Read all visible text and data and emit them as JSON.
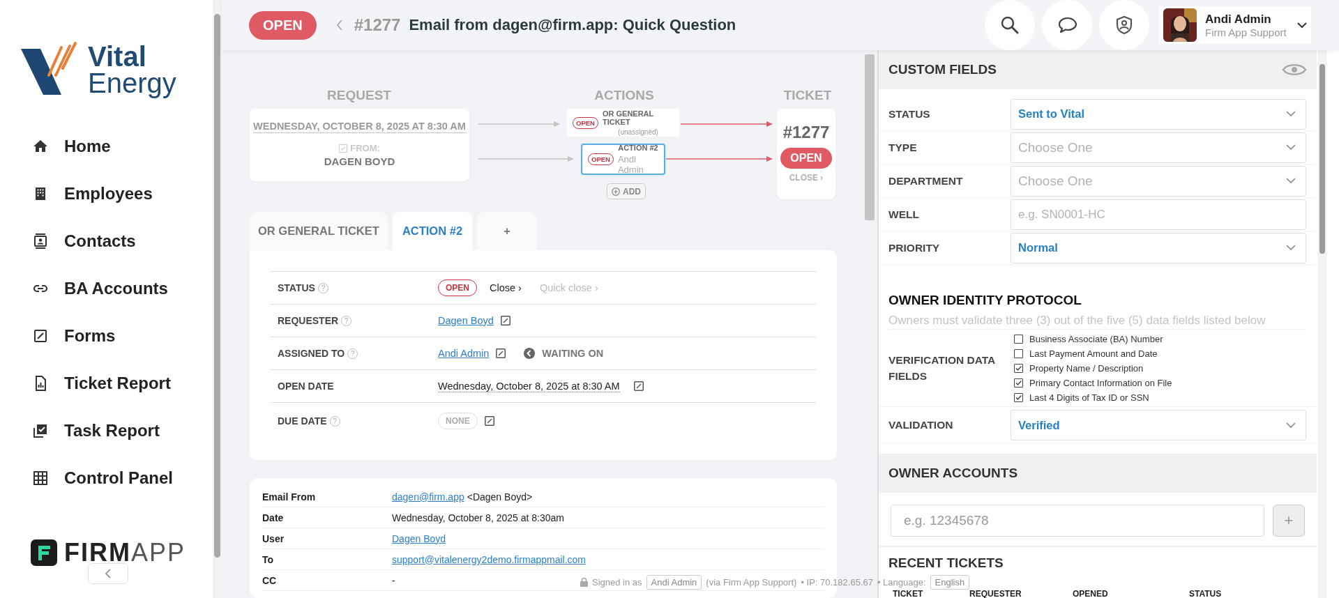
{
  "sidebar": {
    "logo": {
      "line_1": "Vital",
      "line_2": "Energy"
    },
    "items": [
      {
        "label": "Home",
        "selected": false
      },
      {
        "label": "Employees",
        "selected": false
      },
      {
        "label": "Contacts",
        "selected": false
      },
      {
        "label": "BA Accounts",
        "selected": false
      },
      {
        "label": "Forms",
        "selected": false
      },
      {
        "label": "Ticket Report",
        "selected": false
      },
      {
        "label": "Task Report",
        "selected": false
      },
      {
        "label": "Control Panel",
        "selected": false
      }
    ],
    "brand": {
      "bold": "FIRM",
      "light": "APP"
    }
  },
  "header": {
    "status": "OPEN",
    "ticket_number": "#1277",
    "title": "Email from dagen@firm.app: Quick Question",
    "user": {
      "name": "Andi Admin",
      "org": "Firm App Support"
    }
  },
  "flow": {
    "headings": [
      "REQUEST",
      "ACTIONS",
      "TICKET"
    ],
    "request": {
      "date": "WEDNESDAY, OCTOBER 8, 2025 AT 8:30 AM",
      "from_label": "FROM:",
      "from_name": "DAGEN BOYD"
    },
    "actions": [
      {
        "status": "OPEN",
        "title": "OR GENERAL TICKET",
        "subtitle": "(unassigned)",
        "selected": false
      },
      {
        "status": "OPEN",
        "title": "ACTION #2",
        "subtitle": "Andi Admin",
        "selected": true
      }
    ],
    "add_button": "ADD",
    "ticket": {
      "number": "#1277",
      "status": "OPEN",
      "close": "CLOSE ›"
    }
  },
  "tabs": [
    {
      "label": "OR GENERAL TICKET",
      "selected": false
    },
    {
      "label": "ACTION #2",
      "selected": true
    },
    {
      "label": "+",
      "selected": false
    }
  ],
  "details": [
    {
      "kind": "status",
      "label": "STATUS",
      "help": "?",
      "badge": "OPEN",
      "close": "Close ›",
      "quick_close": "Quick close ›"
    },
    {
      "kind": "link",
      "label": "REQUESTER",
      "help": "?",
      "value": "Dagen Boyd"
    },
    {
      "kind": "assignee",
      "label": "ASSIGNED TO",
      "help": "?",
      "value": "Andi Admin",
      "extra": "WAITING ON"
    },
    {
      "kind": "date",
      "label": "OPEN DATE",
      "value": "Wednesday, October 8, 2025 at 8:30 AM"
    },
    {
      "kind": "none",
      "label": "DUE DATE",
      "help": "?",
      "value": "NONE"
    }
  ],
  "email": [
    {
      "label": "Email From",
      "link": "dagen@firm.app",
      "text": "<Dagen Boyd>"
    },
    {
      "label": "Date",
      "text": "Wednesday, October 8, 2025 at 8:30am"
    },
    {
      "label": "User",
      "link": "Dagen Boyd"
    },
    {
      "label": "To",
      "link": "support@vitalenergy2demo.firmappmail.com"
    },
    {
      "label": "CC",
      "text": "-"
    }
  ],
  "footer": {
    "signed_in": "Signed in as",
    "user": "Andi Admin",
    "via": "(via Firm App Support)",
    "ip": "• IP: 70.182.65.67",
    "language_label": "• Language:",
    "language": "English"
  },
  "custom_fields": {
    "title": "CUSTOM FIELDS",
    "fields": [
      {
        "kind": "select",
        "label": "STATUS",
        "value": "Sent to Vital"
      },
      {
        "kind": "select",
        "label": "TYPE",
        "placeholder": "Choose One"
      },
      {
        "kind": "select",
        "label": "DEPARTMENT",
        "placeholder": "Choose One"
      },
      {
        "kind": "input",
        "label": "WELL",
        "placeholder": "e.g. SN0001-HC"
      },
      {
        "kind": "select",
        "label": "PRIORITY",
        "value": "Normal"
      }
    ]
  },
  "identity": {
    "title": "OWNER IDENTITY PROTOCOL",
    "note": "Owners must validate three (3) out of the five (5) data fields listed below",
    "fields_label": "VERIFICATION DATA FIELDS",
    "checks": [
      {
        "label": "Business Associate (BA) Number",
        "checked": false
      },
      {
        "label": "Last Payment Amount and Date",
        "checked": false
      },
      {
        "label": "Property Name / Description",
        "checked": true
      },
      {
        "label": "Primary Contact Information on File",
        "checked": true
      },
      {
        "label": "Last 4 Digits of Tax ID or SSN",
        "checked": true
      }
    ],
    "validation": {
      "label": "VALIDATION",
      "value": "Verified"
    }
  },
  "owner_accounts": {
    "title": "OWNER ACCOUNTS",
    "placeholder": "e.g. 12345678",
    "add_button": "+"
  },
  "recent_tickets": {
    "title": "RECENT TICKETS",
    "columns": [
      "TICKET",
      "REQUESTER",
      "OPENED",
      "STATUS"
    ]
  }
}
